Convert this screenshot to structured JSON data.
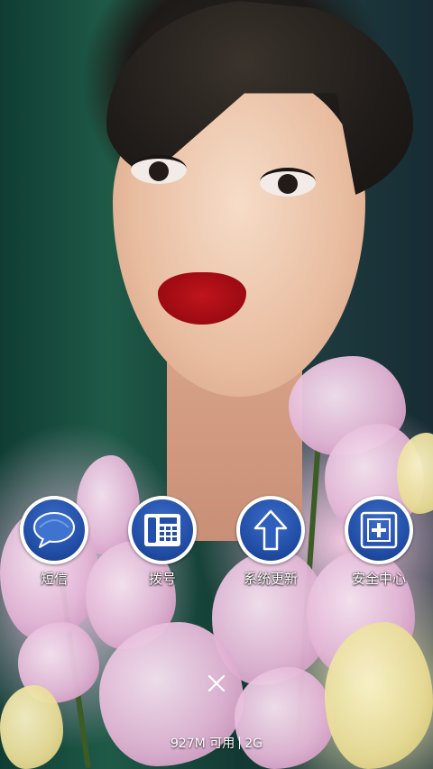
{
  "shortcuts": [
    {
      "label": "短信",
      "icon": "message-bubble-icon"
    },
    {
      "label": "拨号",
      "icon": "phone-dialpad-icon"
    },
    {
      "label": "系统更新",
      "icon": "arrow-up-icon"
    },
    {
      "label": "安全中心",
      "icon": "shield-plus-icon"
    }
  ],
  "memory": {
    "available": "927M 可用",
    "network": "2G"
  },
  "close_icon": "close-icon",
  "colors": {
    "icon_blue": "#224fa8",
    "ring": "#ffffff",
    "text": "#ffffff"
  }
}
